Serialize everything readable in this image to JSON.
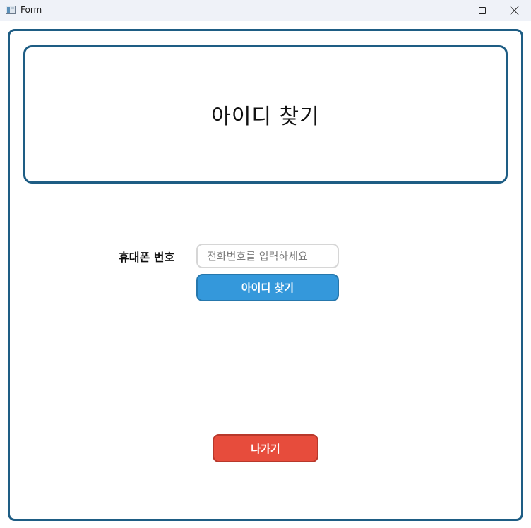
{
  "window": {
    "title": "Form",
    "icon": "form-app-icon"
  },
  "controls": {
    "minimize_icon": "minimize-icon",
    "maximize_icon": "maximize-icon",
    "close_icon": "close-icon"
  },
  "header": {
    "title": "아이디 찾기"
  },
  "form": {
    "phone_label": "휴대폰 번호",
    "phone_value": "",
    "phone_placeholder": "전화번호를 입력하세요",
    "find_button_label": "아이디 찾기",
    "exit_button_label": "나가기"
  },
  "colors": {
    "frame": "#1e5d84",
    "primary_button": "#3498db",
    "danger_button": "#e74c3c"
  }
}
